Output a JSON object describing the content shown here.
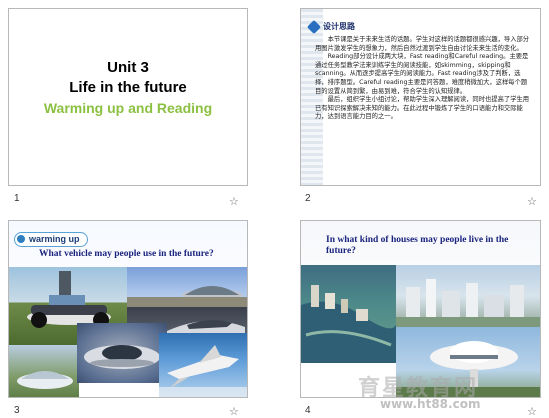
{
  "slides": [
    {
      "number": "1",
      "title_lines": [
        "Unit 3",
        "Life in the future",
        "Warming up and Reading"
      ],
      "accent_color": "#8cc043"
    },
    {
      "number": "2",
      "header": "设计思路",
      "paragraphs": [
        "本节课是关于未来生活的话题。学生对这样的话题都很感兴趣，导入部分用图片激发学生的想象力，然后自然过渡到学生自由讨论未来生活的变化。",
        "Reading部分设计成两大块，Fast reading和Careful reading。主要是通过任务型教学法来训练学生的阅读技能，如skimming，skipping和scanning。从而逐步提高学生的阅读能力。Fast reading涉及了判断，选择，排序题型。Careful reading主要是问答题，难度稍微加大，这样每个题目的设置从简到繁，由易到难，符合学生的认知规律。",
        "最后，组织学生小组讨论，帮助学生深入理解阅读，同时也提高了学生用已有知识探索解决未知的能力。在此过程中锻炼了学生的口语能力和交际能力，达到语言能力目的之一。"
      ]
    },
    {
      "number": "3",
      "badge": "warming up",
      "question": "What vehicle may people use in the future?"
    },
    {
      "number": "4",
      "question": "In what kind of houses may people live in the future?"
    }
  ],
  "star_glyph": "☆",
  "watermark": {
    "text": "育星教育网",
    "url": "www.ht88.com"
  }
}
